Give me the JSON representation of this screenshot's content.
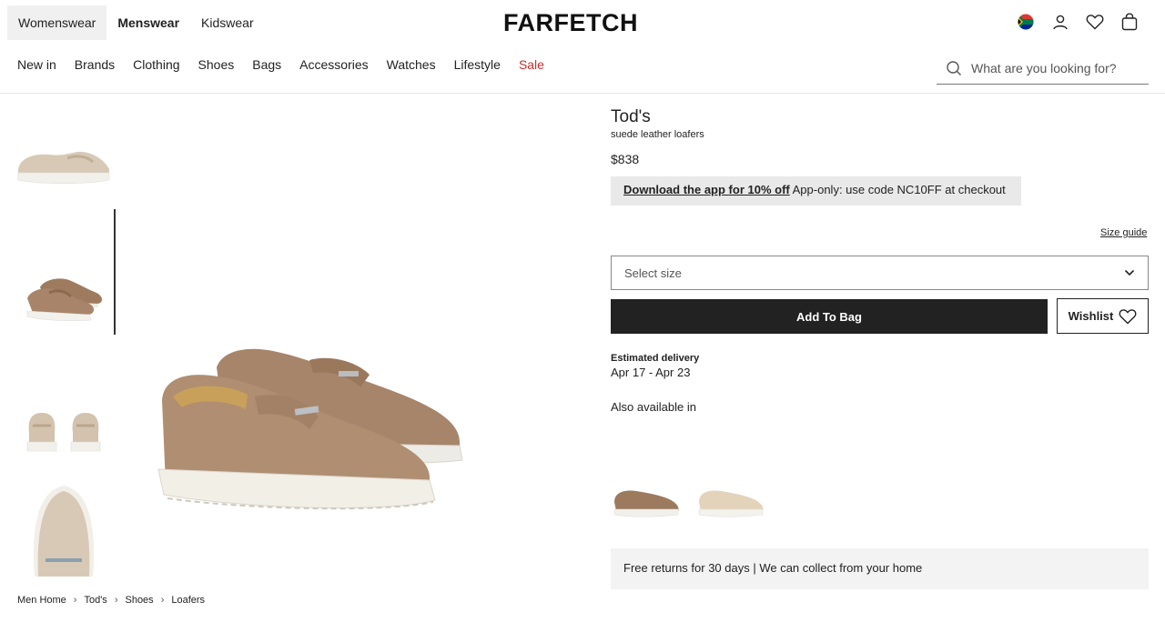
{
  "header": {
    "gender_tabs": [
      "Womenswear",
      "Menswear",
      "Kidswear"
    ],
    "logo": "FARFETCH",
    "icons": [
      "south-africa-flag-icon",
      "account-icon",
      "heart-icon",
      "bag-icon"
    ]
  },
  "nav": {
    "items": [
      "New in",
      "Brands",
      "Clothing",
      "Shoes",
      "Bags",
      "Accessories",
      "Watches",
      "Lifestyle",
      "Sale"
    ],
    "sale_color": "#c8302b"
  },
  "search": {
    "placeholder": "What are you looking for?"
  },
  "product": {
    "brand": "Tod's",
    "name": "suede leather loafers",
    "price": "$838",
    "promo_link": "Download the app for 10% off",
    "promo_text": "App-only: use code NC10FF at checkout",
    "size_guide": "Size guide",
    "size_placeholder": "Select size",
    "add_to_bag": "Add To Bag",
    "wishlist": "Wishlist",
    "est_delivery_label": "Estimated delivery",
    "est_delivery_dates": "Apr 17 - Apr 23",
    "also_available": "Also available in",
    "returns": "Free returns for 30 days | We can collect from your home"
  },
  "breadcrumb": [
    "Men Home",
    "Tod's",
    "Shoes",
    "Loafers"
  ]
}
